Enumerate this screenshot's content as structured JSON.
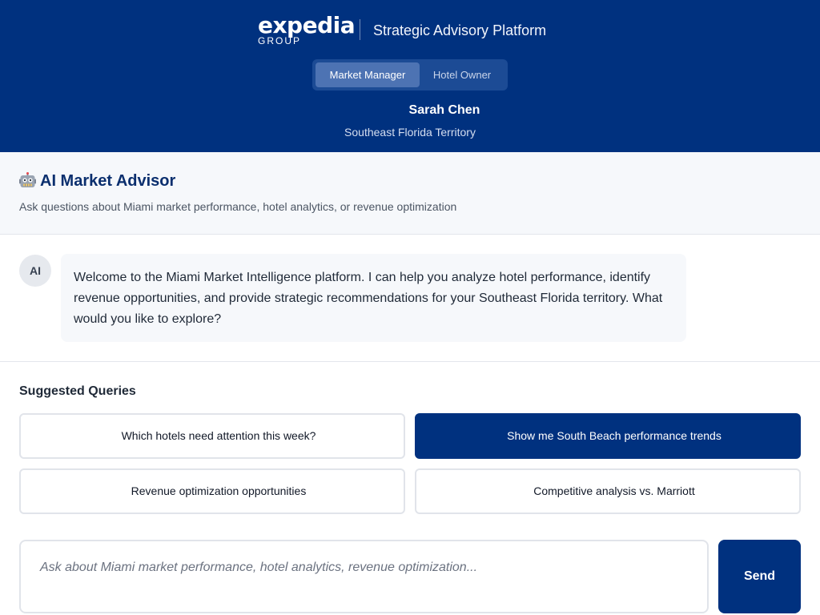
{
  "header": {
    "logo_word": "expedia",
    "logo_sub": "GROUP",
    "platform_title": "Strategic Advisory Platform",
    "roles": [
      {
        "label": "Market Manager",
        "active": true
      },
      {
        "label": "Hotel Owner",
        "active": false
      }
    ],
    "user_name": "Sarah Chen",
    "user_territory": "Southeast Florida Territory"
  },
  "advisor": {
    "icon": "robot-icon",
    "title": "AI Market Advisor",
    "subtitle": "Ask questions about Miami market performance, hotel analytics, or revenue optimization"
  },
  "chat": {
    "messages": [
      {
        "sender": "AI",
        "text": "Welcome to the Miami Market Intelligence platform. I can help you analyze hotel performance, identify revenue opportunities, and provide strategic recommendations for your Southeast Florida territory. What would you like to explore?"
      }
    ]
  },
  "suggestions": {
    "title": "Suggested Queries",
    "items": [
      {
        "label": "Which hotels need attention this week?",
        "selected": false
      },
      {
        "label": "Show me South Beach performance trends",
        "selected": true
      },
      {
        "label": "Revenue optimization opportunities",
        "selected": false
      },
      {
        "label": "Competitive analysis vs. Marriott",
        "selected": false
      }
    ]
  },
  "composer": {
    "placeholder": "Ask about Miami market performance, hotel analytics, revenue optimization...",
    "value": "",
    "send_label": "Send"
  },
  "colors": {
    "brand_navy": "#00317f",
    "role_active": "#4d73b3",
    "panel_bg": "#f6f8fb"
  }
}
